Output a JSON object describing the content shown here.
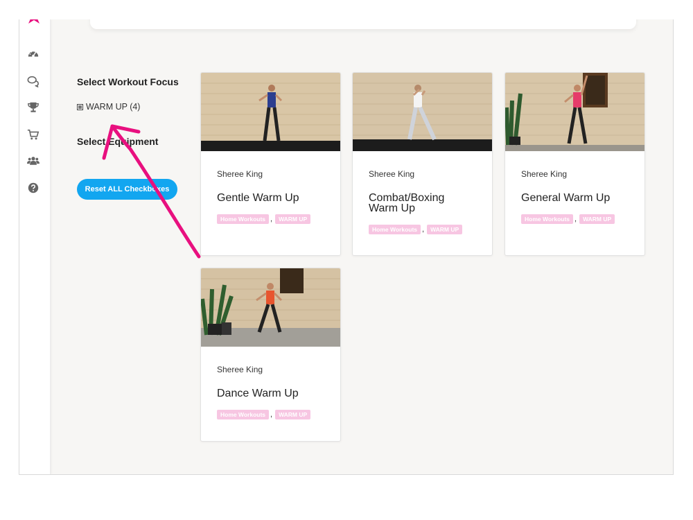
{
  "sidebar": {
    "items": [
      {
        "icon": "dashboard-icon"
      },
      {
        "icon": "chat-icon"
      },
      {
        "icon": "trophy-icon"
      },
      {
        "icon": "cart-icon"
      },
      {
        "icon": "users-icon"
      },
      {
        "icon": "help-icon"
      }
    ]
  },
  "filters": {
    "focus_heading": "Select Workout Focus",
    "focus_option": "WARM UP (4)",
    "equipment_heading": "Select Equipment",
    "reset_label": "Reset ALL Checkboxes"
  },
  "cards": [
    {
      "author": "Sheree King",
      "title": "Gentle Warm Up",
      "tags": [
        "Home Workouts",
        "WARM UP"
      ]
    },
    {
      "author": "Sheree King",
      "title": "Combat/Boxing Warm Up",
      "tags": [
        "Home Workouts",
        "WARM UP"
      ]
    },
    {
      "author": "Sheree King",
      "title": "General Warm Up",
      "tags": [
        "Home Workouts",
        "WARM UP"
      ]
    },
    {
      "author": "Sheree King",
      "title": "Dance Warm Up",
      "tags": [
        "Home Workouts",
        "WARM UP"
      ]
    }
  ],
  "colors": {
    "accent": "#12a6f0",
    "tag_bg": "#f7c6e2",
    "annotation_arrow": "#e8107f",
    "logo": "#e8107f"
  },
  "tag_separator": ","
}
